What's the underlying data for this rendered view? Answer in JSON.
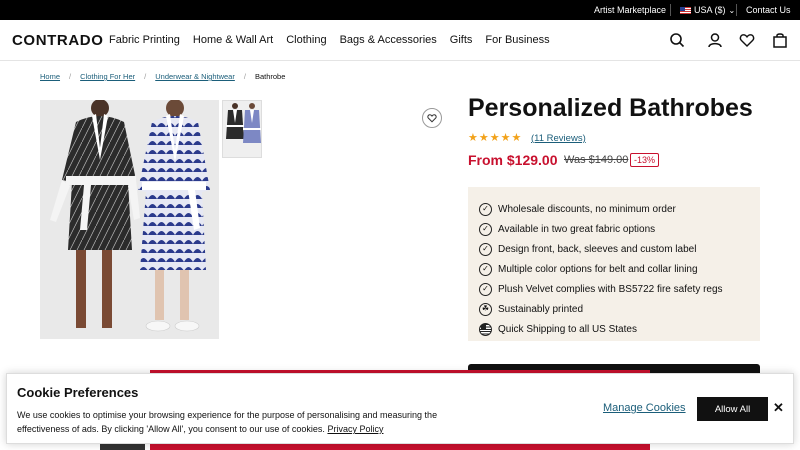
{
  "topbar": {
    "artist": "Artist Marketplace",
    "currency": "USA ($)",
    "contact": "Contact Us"
  },
  "header": {
    "logo": "CONTRADO",
    "nav": [
      "Fabric Printing",
      "Home & Wall Art",
      "Clothing",
      "Bags & Accessories",
      "Gifts",
      "For Business"
    ],
    "icons": [
      "search-icon",
      "account-icon",
      "heart-icon",
      "bag-icon"
    ]
  },
  "breadcrumb": {
    "home": "Home",
    "clothing": "Clothing For Her",
    "underwear": "Underwear & Nightwear",
    "current": "Bathrobe",
    "separator": "/"
  },
  "product": {
    "title": "Personalized Bathrobes",
    "rating": 5,
    "stars": "★★★★★",
    "reviews": "(11 Reviews)",
    "price": "From $129.00",
    "was": "Was $149.00",
    "discount": "-13%",
    "features": [
      {
        "icon": "check-icon",
        "text": "Wholesale discounts, no minimum order"
      },
      {
        "icon": "check-icon",
        "text": "Available in two great fabric options"
      },
      {
        "icon": "check-icon",
        "text": "Design front, back, sleeves and custom label"
      },
      {
        "icon": "check-icon",
        "text": "Multiple color options for belt and collar lining"
      },
      {
        "icon": "check-icon",
        "text": "Plush Velvet complies with BS5722 fire safety regs"
      },
      {
        "icon": "leaf-icon",
        "text": "Sustainably printed"
      },
      {
        "icon": "flag-icon",
        "text": "Quick Shipping to all US States"
      }
    ]
  },
  "cookie": {
    "title": "Cookie Preferences",
    "text": "We use cookies to optimise your browsing experience for the purpose of personalising and measuring the effectiveness of ads. By clicking 'Allow All', you consent to our use of cookies.",
    "policy": "Privacy Policy",
    "manage": "Manage Cookies",
    "allow": "Allow All",
    "close": "✕"
  },
  "colors": {
    "accent_red": "#c8102e",
    "link": "#1b5e7a",
    "star": "#f2a21a",
    "feature_bg": "#f5f0e8"
  }
}
